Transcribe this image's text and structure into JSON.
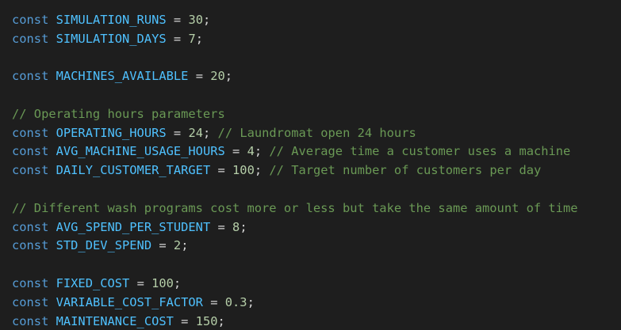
{
  "colors": {
    "background": "#1e1e1e",
    "keyword": "#569cd6",
    "constant": "#4fc1ff",
    "number": "#b5cea8",
    "comment": "#6a9955",
    "text": "#d4d4d4"
  },
  "lines": [
    {
      "type": "code",
      "kw": "const",
      "name": "SIMULATION_RUNS",
      "value": "30",
      "comment": ""
    },
    {
      "type": "code",
      "kw": "const",
      "name": "SIMULATION_DAYS",
      "value": "7",
      "comment": ""
    },
    {
      "type": "blank"
    },
    {
      "type": "code",
      "kw": "const",
      "name": "MACHINES_AVAILABLE",
      "value": "20",
      "comment": ""
    },
    {
      "type": "blank"
    },
    {
      "type": "comment",
      "text": "// Operating hours parameters"
    },
    {
      "type": "code",
      "kw": "const",
      "name": "OPERATING_HOURS",
      "value": "24",
      "comment": "// Laundromat open 24 hours"
    },
    {
      "type": "code",
      "kw": "const",
      "name": "AVG_MACHINE_USAGE_HOURS",
      "value": "4",
      "comment": "// Average time a customer uses a machine"
    },
    {
      "type": "code",
      "kw": "const",
      "name": "DAILY_CUSTOMER_TARGET",
      "value": "100",
      "comment": "// Target number of customers per day"
    },
    {
      "type": "blank"
    },
    {
      "type": "comment",
      "text": "// Different wash programs cost more or less but take the same amount of time"
    },
    {
      "type": "code",
      "kw": "const",
      "name": "AVG_SPEND_PER_STUDENT",
      "value": "8",
      "comment": ""
    },
    {
      "type": "code",
      "kw": "const",
      "name": "STD_DEV_SPEND",
      "value": "2",
      "comment": ""
    },
    {
      "type": "blank"
    },
    {
      "type": "code",
      "kw": "const",
      "name": "FIXED_COST",
      "value": "100",
      "comment": ""
    },
    {
      "type": "code",
      "kw": "const",
      "name": "VARIABLE_COST_FACTOR",
      "value": "0.3",
      "comment": ""
    },
    {
      "type": "code",
      "kw": "const",
      "name": "MAINTENANCE_COST",
      "value": "150",
      "comment": ""
    }
  ]
}
